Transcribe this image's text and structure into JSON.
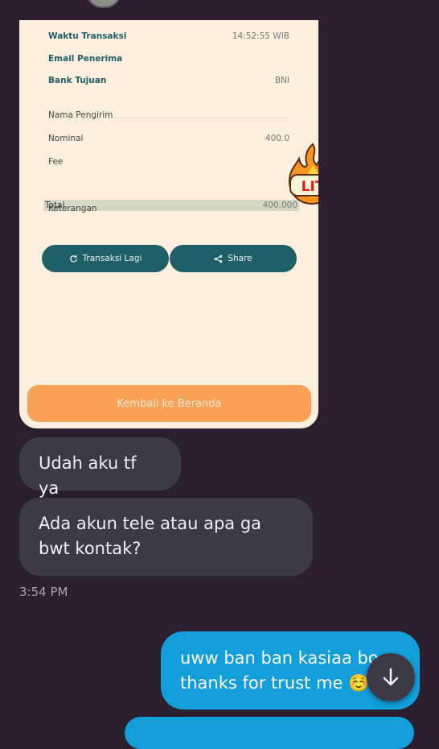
{
  "receipt": {
    "rows": [
      {
        "label": "Waktu Transaksi",
        "value": "14:52:55 WIB"
      },
      {
        "label": "Email Penerima",
        "value": ""
      },
      {
        "label": "Bank Tujuan",
        "value": "BNI"
      }
    ],
    "details": [
      {
        "label": "Nama Pengirim",
        "value": ""
      },
      {
        "label": "Nominal",
        "value": "400.0"
      },
      {
        "label": "Fee",
        "value": ""
      }
    ],
    "total": {
      "label": "Total",
      "value": "400.000"
    },
    "keterangan_label": "Keterangan",
    "buttons": {
      "again": "Transaksi Lagi",
      "share": "Share"
    },
    "home_button": "Kembali ke Beranda",
    "sticker_text": "LIT"
  },
  "messages": {
    "incoming": [
      "Udah aku tf ya",
      "Ada akun tele atau apa ga bwt kontak?"
    ],
    "time": "3:54 PM",
    "outgoing_line1": "uww ban ban kasiaa bo",
    "outgoing_line2": "thanks for trust me",
    "outgoing_emoji": "☺️"
  },
  "icons": [
    "refresh-icon",
    "share-icon",
    "arrow-down-icon",
    "fire-sticker"
  ],
  "colors": {
    "background": "#2a1f2c",
    "incoming_bubble": "#3d3a46",
    "outgoing_bubble": "#119ed9",
    "receipt_bg": "#fdefdd",
    "receipt_button": "#1f5f68",
    "home_button": "#f8a257"
  }
}
